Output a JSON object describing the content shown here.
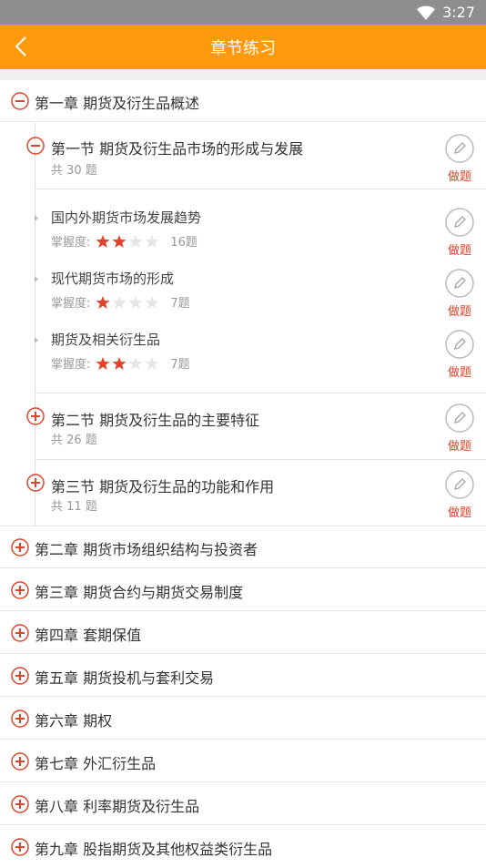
{
  "status": {
    "time": "3:27"
  },
  "header": {
    "title": "章节练习"
  },
  "chapter1": {
    "title": "第一章 期货及衍生品概述",
    "sec1": {
      "title": "第一节 期货及衍生品市场的形成与发展",
      "count": "共 30 题",
      "action": "做题",
      "points": [
        {
          "title": "国内外期货市场发展趋势",
          "mastery_label": "掌握度:",
          "stars": 2,
          "questions": "16题",
          "action": "做题"
        },
        {
          "title": "现代期货市场的形成",
          "mastery_label": "掌握度:",
          "stars": 1,
          "questions": "7题",
          "action": "做题"
        },
        {
          "title": "期货及相关衍生品",
          "mastery_label": "掌握度:",
          "stars": 2,
          "questions": "7题",
          "action": "做题"
        }
      ]
    },
    "sec2": {
      "title": "第二节 期货及衍生品的主要特征",
      "count": "共 26 题",
      "action": "做题"
    },
    "sec3": {
      "title": "第三节 期货及衍生品的功能和作用",
      "count": "共 11 题",
      "action": "做题"
    }
  },
  "chapters": [
    "第二章 期货市场组织结构与投资者",
    "第三章 期货合约与期货交易制度",
    "第四章 套期保值",
    "第五章 期货投机与套利交易",
    "第六章 期权",
    "第七章 外汇衍生品",
    "第八章 利率期货及衍生品",
    "第九章 股指期货及其他权益类衍生品"
  ],
  "colors": {
    "accent": "#ff9a0c",
    "toggle": "#e0442a",
    "star_on": "#e0442a",
    "star_off": "#e6e6e6"
  }
}
